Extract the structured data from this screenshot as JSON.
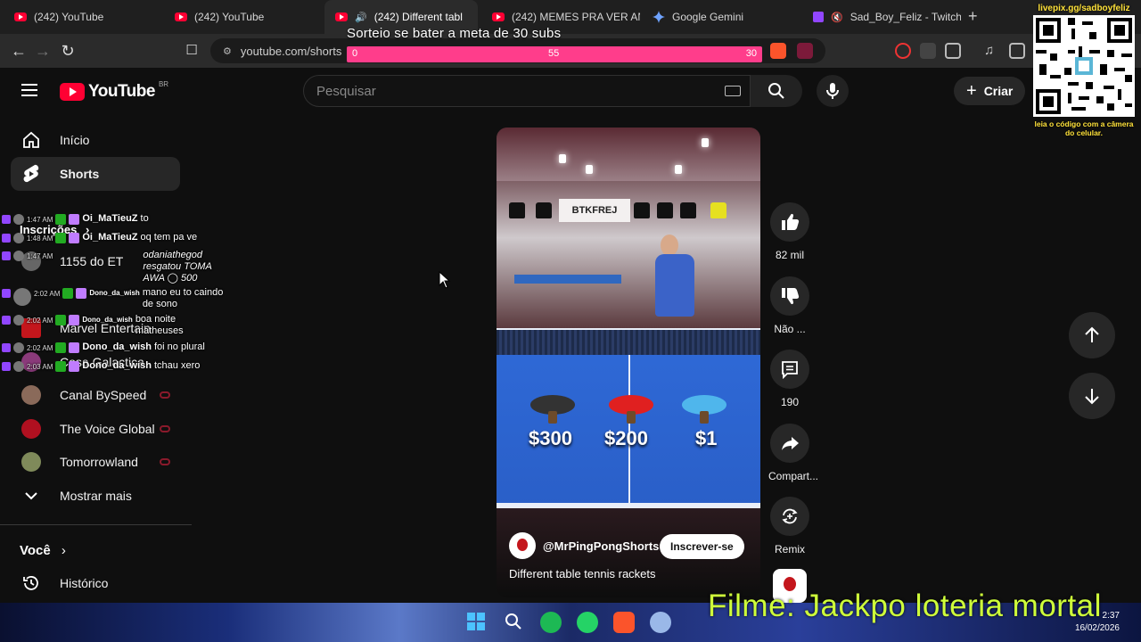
{
  "browser": {
    "tabs": [
      {
        "title": "(242) YouTube",
        "icon": "youtube-icon"
      },
      {
        "title": "(242) YouTube",
        "icon": "youtube-icon"
      },
      {
        "title": "(242) Different tabl",
        "icon": "youtube-icon",
        "active": true
      },
      {
        "title": "(242) MEMES PRA VER AN",
        "icon": "youtube-icon"
      },
      {
        "title": "Google Gemini",
        "icon": "gemini-icon"
      },
      {
        "title": "Sad_Boy_Feliz - Twitch",
        "icon": "twitch-icon"
      }
    ],
    "new_tab": "+",
    "url": "youtube.com/shorts"
  },
  "overlay": {
    "goal_title": "Sorteio se bater a meta de 30 subs",
    "goal_start": "0",
    "goal_mid": "55",
    "goal_end": "30",
    "qr_link": "livepix.gg/sadboyfeliz",
    "qr_caption": "leia o código com a câmera do celular.",
    "movie_caption": "Filme: Jackpo loteria mortal"
  },
  "youtube": {
    "logo": "YouTube",
    "country": "BR",
    "search_placeholder": "Pesquisar",
    "create_label": "Criar",
    "sidebar": {
      "home": "Início",
      "shorts": "Shorts",
      "subscriptions": "Inscrições",
      "channels": [
        {
          "name": "1155 do ET"
        },
        {
          "name": "Marvel Entertain"
        },
        {
          "name": "Cosa Galactica"
        },
        {
          "name": "Canal BySpeed"
        },
        {
          "name": "The Voice Global"
        },
        {
          "name": "Tomorrowland"
        }
      ],
      "show_more": "Mostrar mais",
      "you": "Você",
      "history": "Histórico"
    },
    "short": {
      "banner_text": "BTKFREJ",
      "prices": [
        "$300",
        "$200",
        "$1"
      ],
      "channel": "@MrPingPongShorts",
      "subscribe": "Inscrever-se",
      "title": "Different table tennis rackets"
    },
    "actions": {
      "likes": "82 mil",
      "dislike": "Não ...",
      "comments": "190",
      "share": "Compart...",
      "remix": "Remix"
    }
  },
  "chat": [
    {
      "time": "1:47 AM",
      "user": "Oi_MaTieuZ",
      "msg": "to"
    },
    {
      "time": "1:48 AM",
      "user": "Oi_MaTieuZ",
      "msg": "oq tem pa ve"
    },
    {
      "time": "1:47 AM",
      "user": "",
      "msg": "odaniathegod resgatou TOMA AWA ◯ 500"
    },
    {
      "time": "2:02 AM",
      "user": "Dono_da_wish",
      "msg": "mano eu to caindo de sono"
    },
    {
      "time": "2:02 AM",
      "user": "Dono_da_wish",
      "msg": "boa noite matheuses"
    },
    {
      "time": "2:02 AM",
      "user": "Dono_da_wish",
      "msg": "foi no plural"
    },
    {
      "time": "2:03 AM",
      "user": "Dono_da_wish",
      "msg": "tchau xero"
    }
  ],
  "taskbar": {
    "time": "2:37",
    "date": "16/02/2026"
  }
}
